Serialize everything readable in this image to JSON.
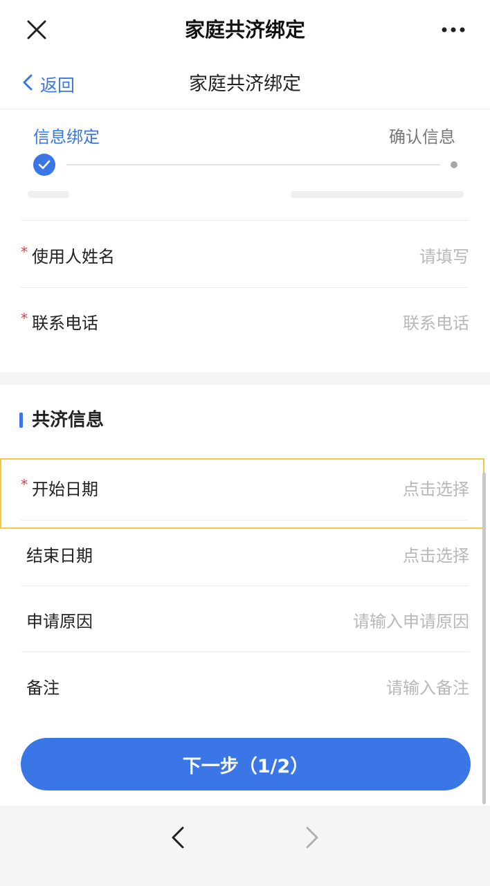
{
  "topbar": {
    "title": "家庭共济绑定"
  },
  "navbar": {
    "back_label": "返回",
    "title": "家庭共济绑定"
  },
  "steps": {
    "step1": "信息绑定",
    "step2": "确认信息",
    "current_step": 1
  },
  "user_fields": [
    {
      "label": "使用人姓名",
      "placeholder": "请填写",
      "required": true
    },
    {
      "label": "联系电话",
      "placeholder": "联系电话",
      "required": true
    }
  ],
  "section": {
    "title": "共济信息"
  },
  "mutual_fields": [
    {
      "label": "开始日期",
      "placeholder": "点击选择",
      "required": true
    },
    {
      "label": "结束日期",
      "placeholder": "点击选择",
      "required": false
    },
    {
      "label": "申请原因",
      "placeholder": "请输入申请原因",
      "required": false
    },
    {
      "label": "备注",
      "placeholder": "请输入备注",
      "required": false
    }
  ],
  "required_mark": "*",
  "next_button": {
    "label": "下一步（1/2）"
  },
  "colors": {
    "accent": "#3a76e6",
    "required": "#e23b3b",
    "highlight": "#f2c84b"
  },
  "icons": {
    "close": "close-icon",
    "more": "more-icon",
    "back": "chevron-left-icon",
    "check": "check-icon",
    "nav_back": "chevron-left-icon",
    "nav_forward": "chevron-right-icon"
  }
}
